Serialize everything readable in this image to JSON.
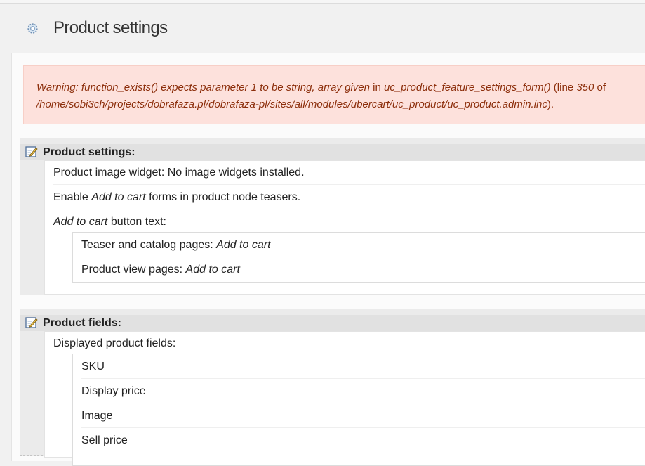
{
  "page": {
    "title": "Product settings"
  },
  "warning": {
    "prefix": "Warning",
    "message": ": function_exists() expects parameter 1 to be string, array given",
    "in_text": " in ",
    "function": "uc_product_feature_settings_form()",
    "line_prefix": " (line ",
    "line_number": "350",
    "of_text": " of",
    "path": "/home/sobi3ch/projects/dobrafaza.pl/dobrafaza-pl/sites/all/modules/ubercart/uc_product/uc_product.admin.inc",
    "suffix": ")."
  },
  "product_settings": {
    "legend": "Product settings:",
    "image_widget": "Product image widget: No image widgets installed.",
    "enable_prefix": "Enable ",
    "enable_em": "Add to cart",
    "enable_suffix": " forms in product node teasers.",
    "button_text_em": "Add to cart",
    "button_text_suffix": " button text:",
    "teaser_label": "Teaser and catalog pages: ",
    "teaser_value": "Add to cart",
    "view_label": "Product view pages: ",
    "view_value": "Add to cart"
  },
  "product_fields": {
    "legend": "Product fields:",
    "displayed_label": "Displayed product fields:",
    "fields": [
      "SKU",
      "Display price",
      "Image",
      "Sell price"
    ]
  },
  "icons": {
    "header": "gear-icon",
    "legend": "edit-icon"
  },
  "colors": {
    "warning_bg": "#fde1dc",
    "warning_text": "#8c2e0b",
    "legend_bg": "#e1e1e1"
  }
}
